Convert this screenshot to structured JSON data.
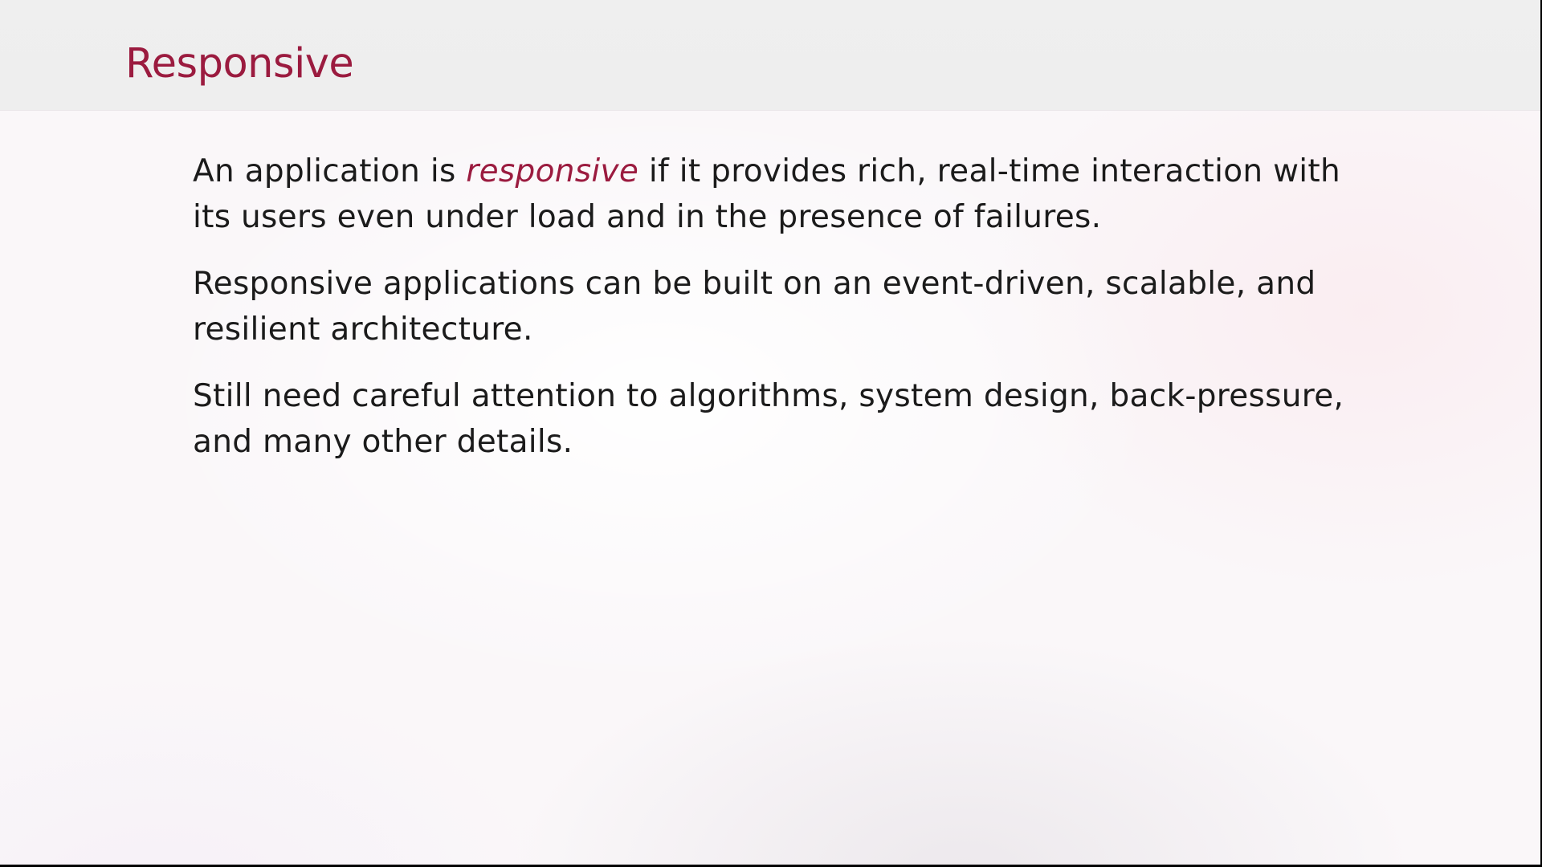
{
  "slide": {
    "title": "Responsive",
    "accent_color": "#9b1b3f",
    "paragraphs": [
      {
        "before": "An application is ",
        "emphasis": "responsive",
        "after": " if it provides rich, real-time interaction with its users even under load and in the presence of failures."
      },
      {
        "text": "Responsive applications can be built on an event-driven, scalable, and resilient architecture."
      },
      {
        "text": "Still need careful attention to algorithms, system design, back-pressure, and many other details."
      }
    ]
  }
}
